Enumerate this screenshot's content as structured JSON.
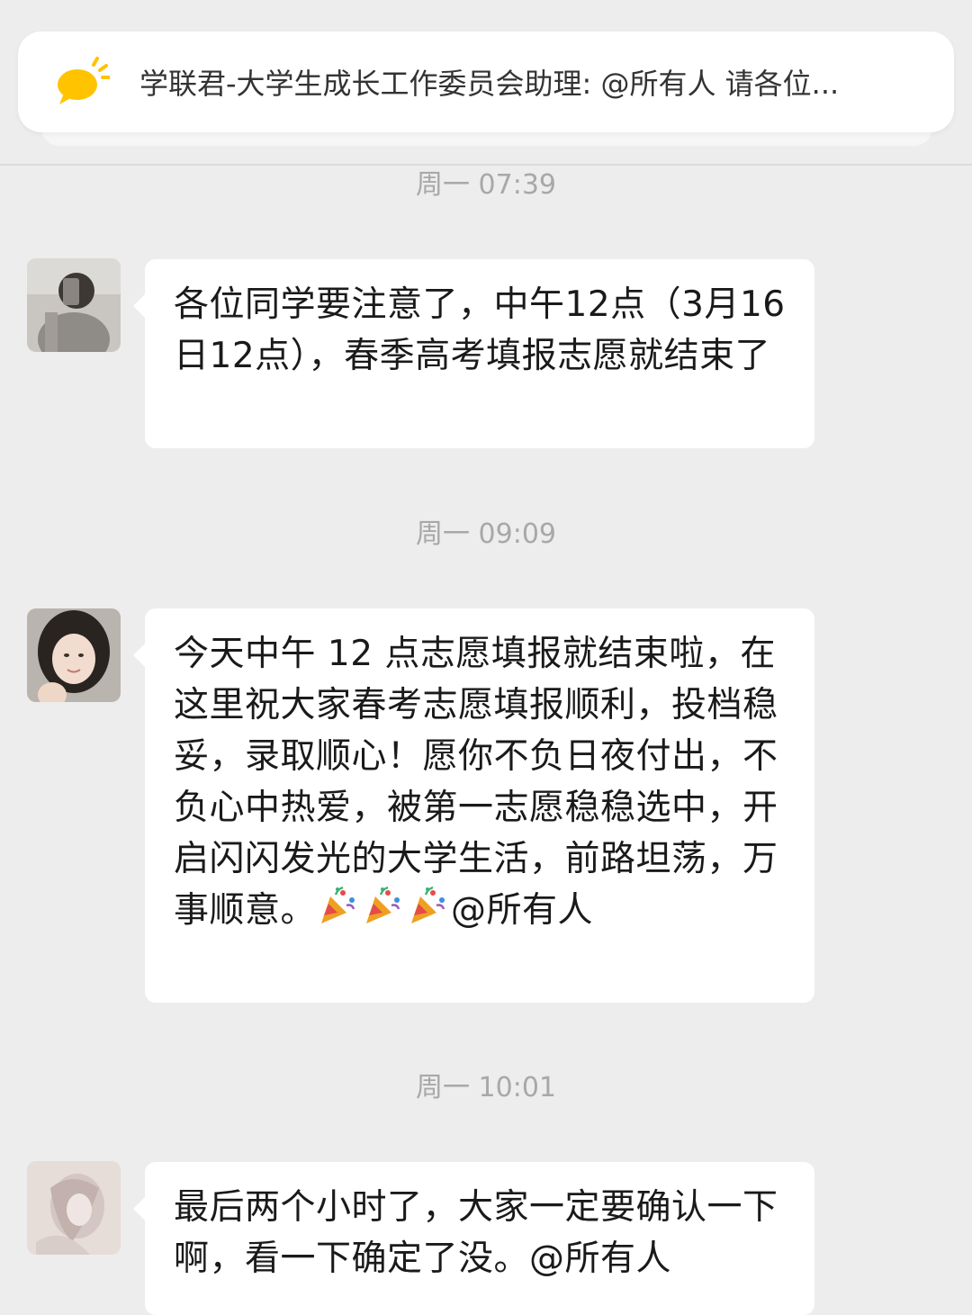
{
  "notice": {
    "icon": "speech-bubble-icon",
    "text": "学联君-大学生成长工作委员会助理: @所有人 请各位..."
  },
  "messages": [
    {
      "timestamp": "周一 07:39",
      "avatar": "avatar-girl-mirror-selfie",
      "text": "各位同学要注意了，中午12点（3月16日12点），春季高考填报志愿就结束了"
    },
    {
      "timestamp": "周一 09:09",
      "avatar": "avatar-girl-portrait",
      "text_before": "今天中午 12 点志愿填报就结束啦，在这里祝大家春考志愿填报顺利，投档稳妥，录取顺心！愿你不负日夜付出，不负心中热爱，被第一志愿稳稳选中，开启闪闪发光的大学生活，前路坦荡，万事顺意。",
      "emoji": "party-popper-icon",
      "emoji_count": 3,
      "text_after": "@所有人"
    },
    {
      "timestamp": "周一 10:01",
      "avatar": "avatar-illustration",
      "text": "最后两个小时了，大家一定要确认一下啊，看一下确定了没。@所有人"
    }
  ],
  "colors": {
    "background": "#ededed",
    "bubble": "#ffffff",
    "timestamp": "#a8a8a8",
    "notice_icon": "#ffc300"
  }
}
